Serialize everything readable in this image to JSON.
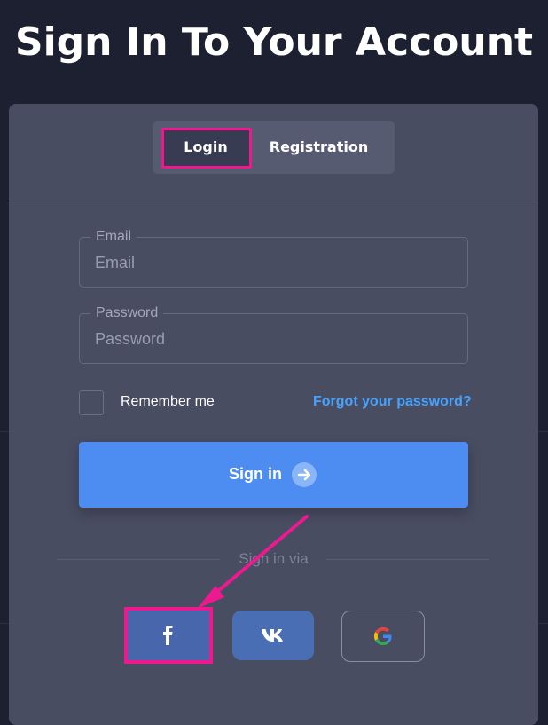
{
  "page": {
    "title": "Sign In To Your Account"
  },
  "tabs": [
    {
      "label": "Login",
      "active": true
    },
    {
      "label": "Registration",
      "active": false
    }
  ],
  "form": {
    "email": {
      "legend": "Email",
      "placeholder": "Email",
      "value": ""
    },
    "password": {
      "legend": "Password",
      "placeholder": "Password",
      "value": ""
    },
    "remember_label": "Remember me",
    "remember_checked": false,
    "forgot_label": "Forgot your password?",
    "signin_label": "Sign in"
  },
  "social": {
    "label": "Sign in via",
    "buttons": [
      {
        "name": "facebook",
        "icon": "facebook-icon",
        "color": "#4866ac"
      },
      {
        "name": "vk",
        "icon": "vk-icon",
        "color": "#4a6eb4"
      },
      {
        "name": "google",
        "icon": "google-icon"
      }
    ]
  },
  "colors": {
    "background": "#1c2031",
    "card": "#494d62",
    "accent": "#4d8cf0",
    "link": "#45a3ff",
    "highlight": "#ec1a8e"
  }
}
